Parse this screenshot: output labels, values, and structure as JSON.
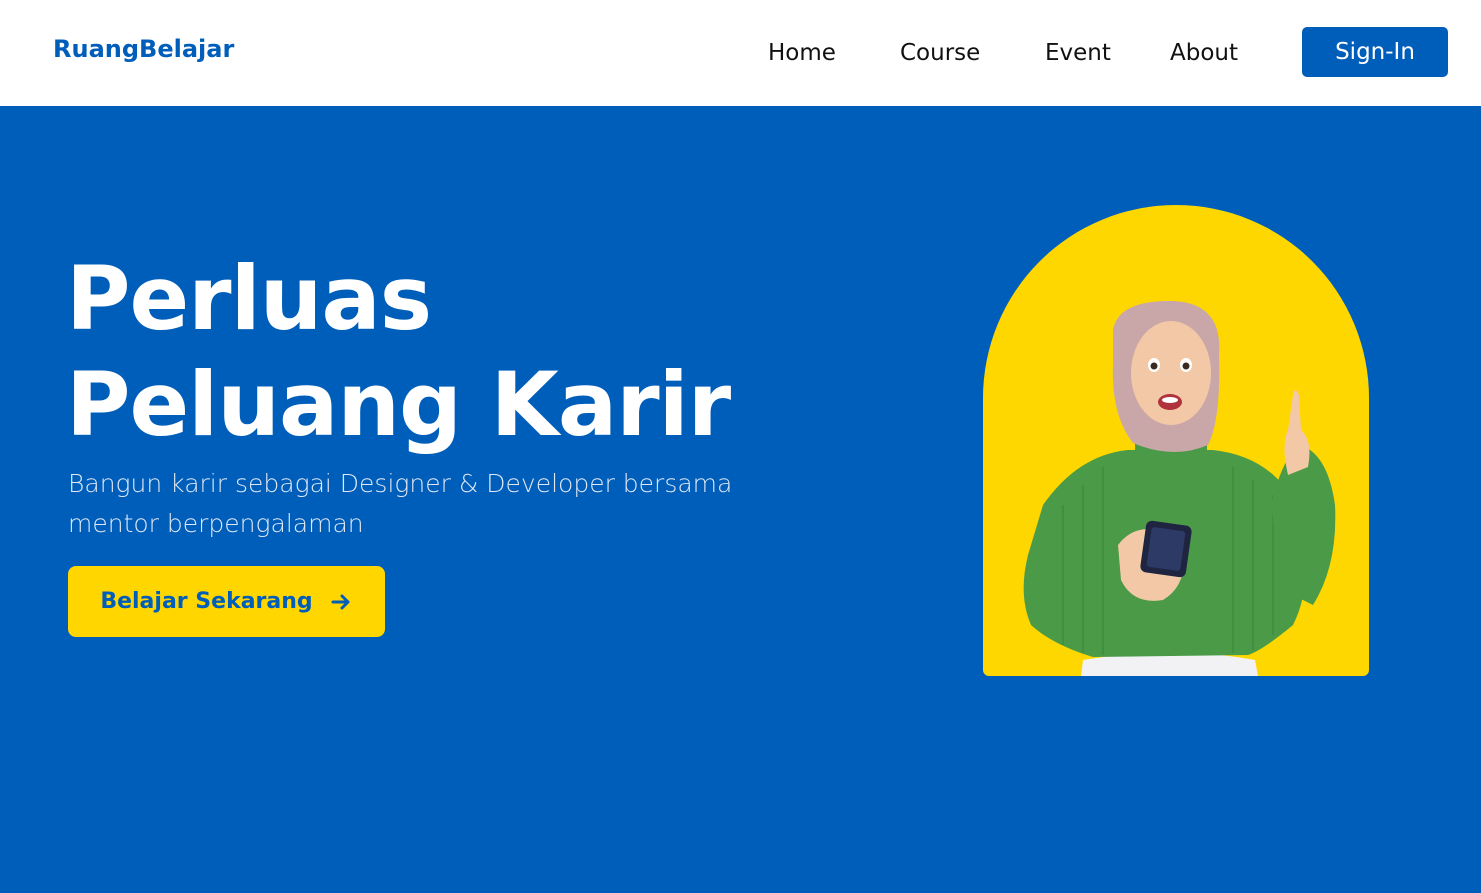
{
  "navbar": {
    "brand": "RuangBelajar",
    "links": [
      "Home",
      "Course",
      "Event",
      "About"
    ],
    "signin_label": "Sign-In"
  },
  "hero": {
    "headline_line1": "Perluas",
    "headline_line2": "Peluang Karir",
    "subtitle_line1": "Bangun karir sebagai Designer & Developer bersama",
    "subtitle_line2": "mentor berpengalaman",
    "cta_label": "Belajar Sekarang",
    "cta_icon": "arrow-right-icon",
    "image_subject": "woman-with-phone-illustration"
  },
  "colors": {
    "primary_blue": "#005EBB",
    "accent_yellow": "#FFD600",
    "nav_bg": "#ffffff",
    "nav_text": "#111111"
  }
}
